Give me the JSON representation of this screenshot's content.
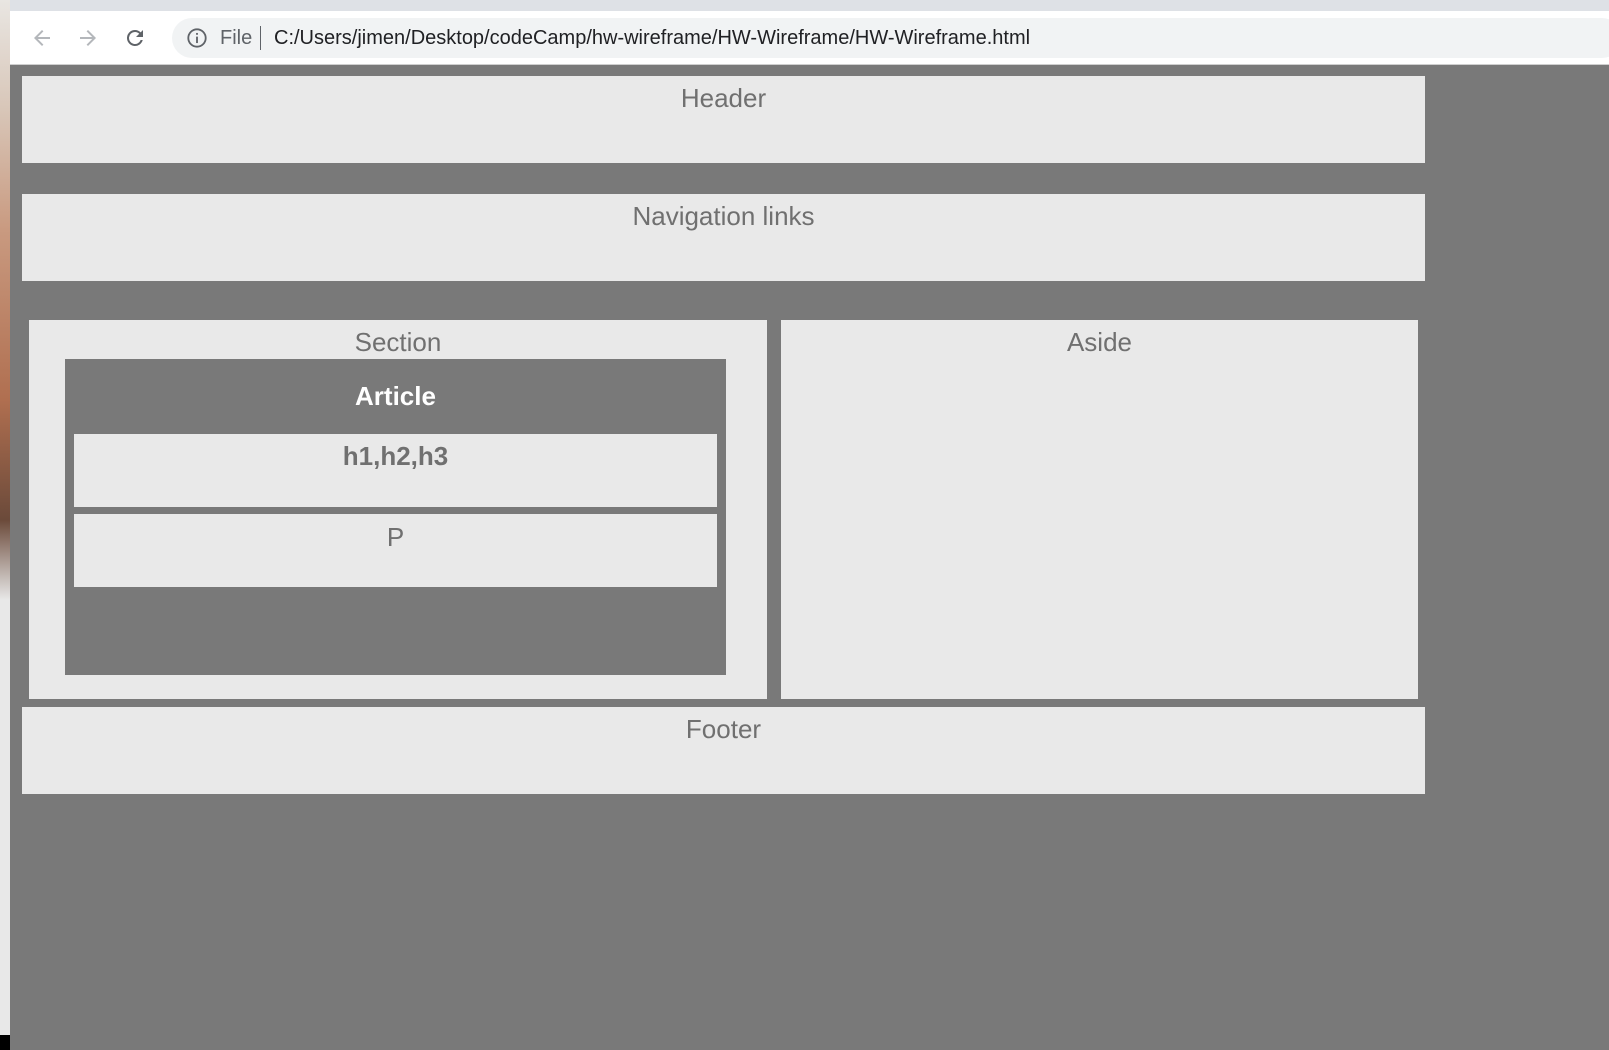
{
  "browser": {
    "back_icon": "arrow-left-icon",
    "forward_icon": "arrow-right-icon",
    "reload_icon": "reload-icon",
    "info_icon": "info-circle-icon",
    "chip_label": "File",
    "url": "C:/Users/jimen/Desktop/codeCamp/hw-wireframe/HW-Wireframe/HW-Wireframe.html"
  },
  "page": {
    "header": "Header",
    "nav": "Navigation links",
    "section": {
      "title": "Section",
      "article": {
        "title": "Article",
        "headings": "h1,h2,h3",
        "paragraph": "P"
      }
    },
    "aside": "Aside",
    "footer": "Footer"
  },
  "colors": {
    "background": "#797979",
    "box": "#e9e9e9",
    "box_text": "#707070",
    "article_title": "#ffffff"
  }
}
